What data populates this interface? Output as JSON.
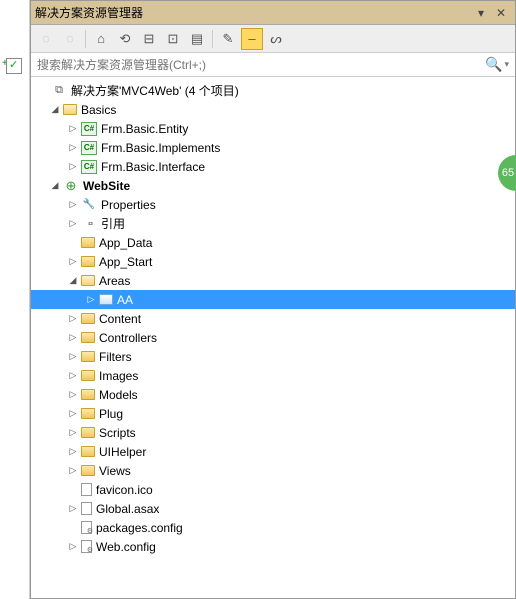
{
  "titlebar": {
    "title": "解决方案资源管理器"
  },
  "search": {
    "placeholder": "搜索解决方案资源管理器(Ctrl+;)"
  },
  "sideBubble": "65",
  "tree": {
    "solution": "解决方案'MVC4Web' (4 个项目)",
    "basics": {
      "label": "Basics",
      "items": [
        "Frm.Basic.Entity",
        "Frm.Basic.Implements",
        "Frm.Basic.Interface"
      ]
    },
    "website": {
      "label": "WebSite",
      "properties": "Properties",
      "references": "引用",
      "appData": "App_Data",
      "appStart": "App_Start",
      "areas": {
        "label": "Areas",
        "aa": "AA"
      },
      "folders": [
        "Content",
        "Controllers",
        "Filters",
        "Images",
        "Models",
        "Plug",
        "Scripts",
        "UIHelper",
        "Views"
      ],
      "files": {
        "favicon": "favicon.ico",
        "global": "Global.asax",
        "packages": "packages.config",
        "webconfig": "Web.config"
      }
    }
  }
}
